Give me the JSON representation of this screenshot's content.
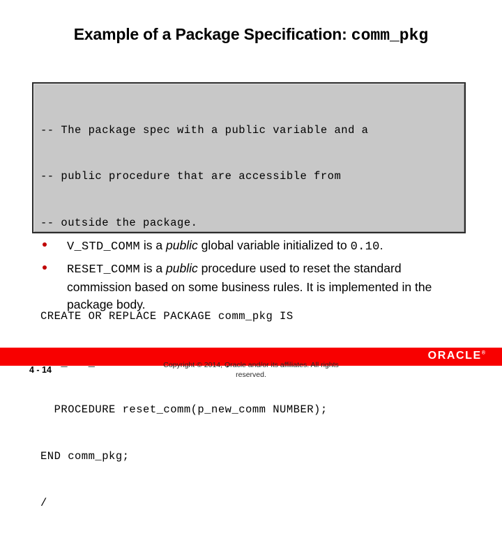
{
  "slide": {
    "title_main": "Example of a Package Specification: ",
    "title_code": "comm_pkg"
  },
  "code_block": {
    "background_color": "#c8c8c8",
    "border_color": "#2b2b2b",
    "lines": [
      "-- The package spec with a public variable and a",
      "-- public procedure that are accessible from",
      "-- outside the package.",
      "",
      "CREATE OR REPLACE PACKAGE comm_pkg IS",
      "  v_std_comm NUMBER := 0.10;  --initialized to 0.10",
      "  PROCEDURE reset_comm(p_new_comm NUMBER);",
      "END comm_pkg;",
      "/"
    ]
  },
  "bullets": {
    "marker_color": "#c00000",
    "items": [
      {
        "code_1": "V_STD_COMM",
        "text_1": " is a ",
        "italic_1": "public",
        "text_2": " global variable initialized to ",
        "code_2": "0.10",
        "text_3": "."
      },
      {
        "code_1": "RESET_COMM",
        "text_1": " is a ",
        "italic_1": "public",
        "text_2": " procedure used to reset the standard commission based on some business rules. It is implemented in the package body."
      }
    ]
  },
  "footer": {
    "bar_color": "#f80000",
    "logo_text": "ORACLE",
    "logo_tm": "®",
    "slide_number": "4 - 14",
    "copyright_line1": "Copyright © 2014, Oracle and/or its affiliates. All rights",
    "copyright_line2": "reserved."
  }
}
